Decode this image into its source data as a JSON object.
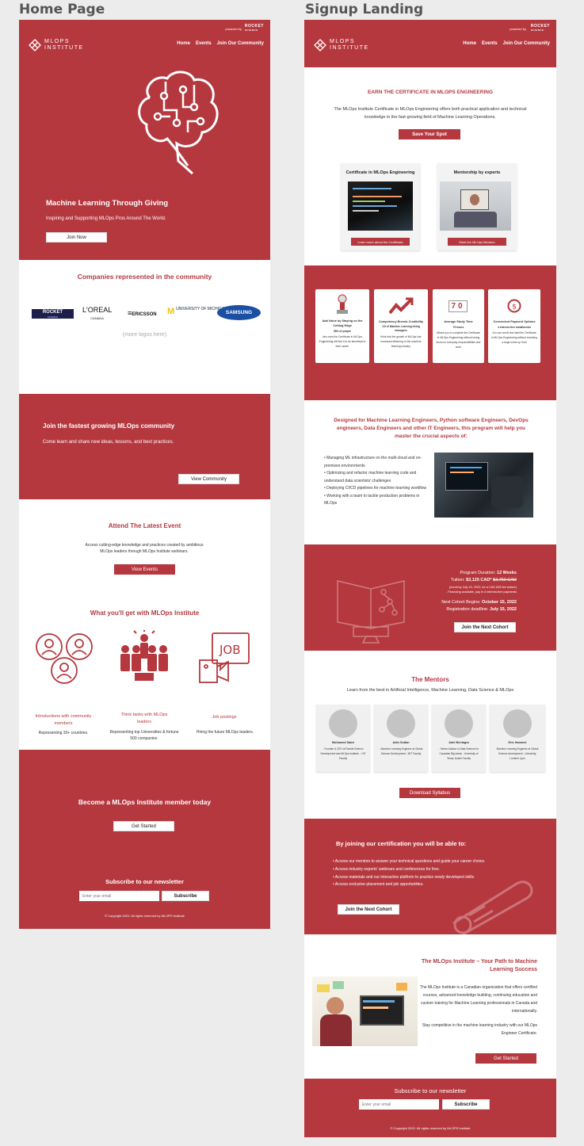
{
  "labels": {
    "home": "Home Page",
    "signup": "Signup Landing"
  },
  "brand": {
    "line1": "MLOPS",
    "line2": "INSTITUTE",
    "powered": "powered by",
    "partner": "ROCKET",
    "partner_sub": "SCIENCE"
  },
  "nav": [
    "Home",
    "Events",
    "Join Our Community"
  ],
  "home": {
    "hero": {
      "title": "Machine Learning Through Giving",
      "subtitle": "Inspiring and Supporting MLOps Pros Around The World.",
      "button": "Join Now"
    },
    "companies": {
      "title": "Companies represented in the community",
      "logos": [
        "ROCKET",
        "L'OREAL",
        "ERICSSON",
        "UNIVERSITY OF MICHIGAN",
        "SAMSUNG"
      ],
      "rocket_sub": "SCIENCE",
      "loreal_sub": "CANADA",
      "more": "(more logos here)"
    },
    "community": {
      "title": "Join the fastest growing MLOps community",
      "subtitle": "Come learn and share new ideas, lessons, and best practices.",
      "button": "View Community"
    },
    "event": {
      "title": "Attend The Latest Event",
      "text": "Access cutting-edge knowledge and practices created by ambitious MLOps leaders through MLOps Institute webinars.",
      "button": "View Events"
    },
    "benefits": {
      "title": "What you'll get with MLOps Institute",
      "items": [
        {
          "title": "Introductions with community members",
          "desc": "Representing 30+ countries."
        },
        {
          "title": "Think tanks with MLOps leaders",
          "desc": "Representing top Universities & fortune 500 companies."
        },
        {
          "title": "Job postings",
          "desc": "Hiring the future MLOps leaders."
        }
      ],
      "job_icon_text": "JOB"
    },
    "member": {
      "title": "Become a MLOps Institute member today",
      "button": "Get Started"
    },
    "newsletter": {
      "title": "Subscribe to our newsletter",
      "placeholder": "Enter your email",
      "button": "Subscribe"
    },
    "copyright": "© Copyright 2022. All rights reserved by MLOPS Institute"
  },
  "signup": {
    "earn": {
      "title": "EARN THE CERTIFICATE IN MLOPS ENGINEERING",
      "text": "The MLOps Institute Certificate in MLOps Engineering offers both practical application and technical knowledge in the fast-growing field of Machine Learning Operations.",
      "button": "Save Your Spot"
    },
    "cards": [
      {
        "title": "Certificate in MLOps Engineering",
        "button": "Learn more about the Certificate"
      },
      {
        "title": "Mentorship by experts",
        "button": "Meet the MLOps Mentors"
      }
    ],
    "features": [
      {
        "title": "Add Value by Staying on the Cutting Edge",
        "stat": "98% of people",
        "desc": "who earn the Certificate in MLOps Engineering will find it to be beneficial to their career"
      },
      {
        "title": "Competency Breeds Credibility",
        "stat": "1/3 of Machine Learning hiring managers",
        "desc": "think that the growth of MLOps has increased efficiency in the machine learning industry"
      },
      {
        "title": "Average Study Time",
        "stat": "70 hours",
        "desc": "Allows you to complete the Certificate in MLOps Engineering without losing focus on everyday responsibilities and work"
      },
      {
        "title": "Convenient Payment Options",
        "stat": "4 interest-free installments",
        "desc": "You can enroll and start the Certificate in MLOps Engineering without investing a large some up front"
      }
    ],
    "feature_num": "70",
    "designed": {
      "title": "Designed for Machine Learning Engineers, Python software Engineers, DevOps engineers, Data Engineers and other IT Engineers, this program will help you master the crucial aspects of:",
      "bullets": [
        "Managing ML infrastructure on the multi-cloud and on-premises environments",
        "Optimizing and refactor machine learning code and understand data scientists' challenges",
        "Deploying CI/CD pipelines for machine learning workflow",
        "Working with a team to tackle production problems in MLOps"
      ]
    },
    "program": {
      "duration_label": "Program Duration:",
      "duration": "12 Weeks",
      "tuition_label": "Tuition:",
      "tuition": "$3,125 CAD*",
      "tuition_old": "$3,750 CAD",
      "early": "(enroll by July 15, 2022, for a CAD 625 fee waiver)",
      "financing": "- Financing available, pay in 4 interest-free payments",
      "cohort_label": "Next Cohort Begins:",
      "cohort": "October 15, 2022",
      "deadline_label": "Registration deadline:",
      "deadline": "July 15, 2022",
      "button": "Join the Next Cohort"
    },
    "mentors": {
      "title": "The Mentors",
      "subtitle": "Learn from the best in Artificial Intelligence, Machine Learning, Data Science & MLOps",
      "people": [
        {
          "name": "Mohamed Sabri",
          "desc": "- Founder & CEO at Rocket Science Development and MLOps Institute. - HIT Faculty"
        },
        {
          "name": "Adin Sultan",
          "desc": "- Machine Learning Engineer at Global Science Development - MIT Faculty"
        },
        {
          "name": "Adel Benlagra",
          "desc": "- Senior Advisor in Data Science for Canadian Big banks - University of Texas, Austin Faculty"
        },
        {
          "name": "Eric Hammel",
          "desc": "Machine Learning Engineer at Global Science development - University, Lumiere Lyon"
        }
      ],
      "button": "Download Syllabus"
    },
    "joining": {
      "title": "By joining our certification you will be able to:",
      "bullets": [
        "Access our mentors to answer your technical questions and guide your career choice.",
        "Access industry experts' webinars and conferences for free.",
        "Access materials and our interactive platform to practice newly developed skills.",
        "Access exclusive placement and job opportunities."
      ],
      "button": "Join the Next Cohort"
    },
    "path": {
      "title": "The MLOps Institute – Your Path to Machine Learning Success",
      "text1": "The MLOps Institute is a Canadian organization that offers certified courses, advanced knowledge building, continuing education and custom training for Machine Learning professionals in Canada and internationally.",
      "text2": "Stay competitive in the machine learning industry with our MLOps Engineer Certificate.",
      "button": "Get Started"
    },
    "newsletter": {
      "title": "Subscribe to our newsletter",
      "placeholder": "Enter your email",
      "button": "Subscribe"
    },
    "copyright": "© Copyright 2022. All rights reserved by MLOPS Institute"
  },
  "colors": {
    "brand": "#b5383f",
    "bg": "#ececec"
  }
}
